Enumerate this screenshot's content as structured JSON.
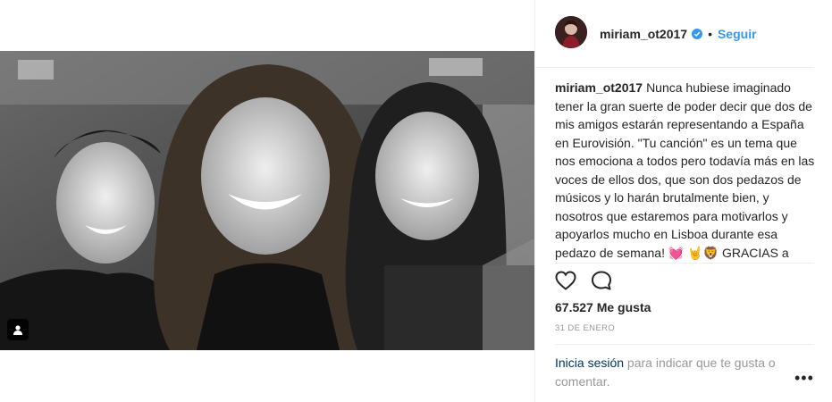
{
  "post": {
    "image_alt": "Fotografía en blanco y negro de tres amigos sonriendo",
    "tag_icon": "user-tag-icon"
  },
  "header": {
    "username": "miriam_ot2017",
    "verified_icon": "verified-badge-icon",
    "separator": "•",
    "follow_label": "Seguir"
  },
  "caption": {
    "username": "miriam_ot2017",
    "text": "Nunca hubiese imaginado tener la gran suerte de poder decir que dos de mis amigos estarán representando a España en Eurovisión. \"Tu canción\" es un tema que nos emociona a todos pero todavía más en las voces de ellos dos, que son dos pedazos de músicos y lo harán brutalmente bien, y nosotros que estaremos para motivarlos y apoyarlos mucho en Lisboa durante esa pedazo de semana! 💓 🤘🦁 GRACIAS a todas las personas que están haciendo posible todo esto y a todos los que nos apoyáis"
  },
  "actions": {
    "like_icon": "heart-icon",
    "comment_icon": "comment-icon"
  },
  "likes": "67.527 Me gusta",
  "date": "31 DE ENERO",
  "login": {
    "link": "Inicia sesión",
    "rest": " para indicar que te gusta o comentar.",
    "more_icon": "more-options-icon"
  },
  "colors": {
    "accent": "#3897f0",
    "text": "#262626",
    "muted": "#999999",
    "link": "#003569"
  }
}
